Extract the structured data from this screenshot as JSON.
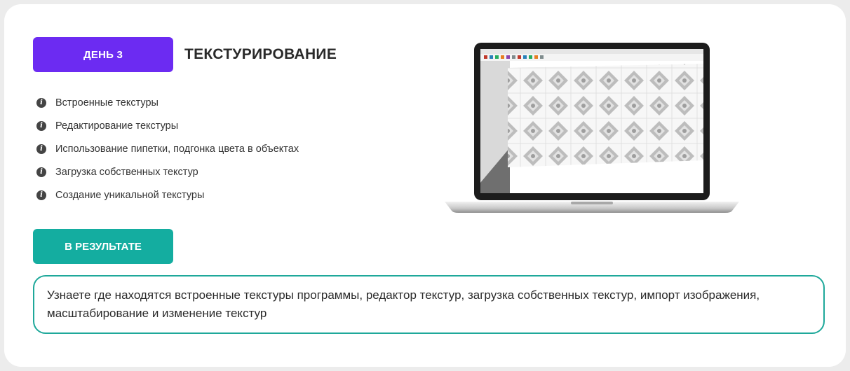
{
  "module": {
    "day_label": "ДЕНЬ 3",
    "title": "ТЕКСТУРИРОВАНИЕ",
    "accent_color": "#6c2bf2"
  },
  "topics": [
    {
      "icon": "info-icon",
      "label": "Встроенные текстуры"
    },
    {
      "icon": "info-icon",
      "label": "Редактирование текстуры"
    },
    {
      "icon": "info-icon",
      "label": "Использование пипетки, подгонка цвета в объектах"
    },
    {
      "icon": "info-icon",
      "label": "Загрузка собственных текстур"
    },
    {
      "icon": "info-icon",
      "label": "Создание уникальной текстуры"
    }
  ],
  "result": {
    "button_label": "В РЕЗУЛЬТАТЕ",
    "button_color": "#14ada0",
    "description": "Узнаете где находятся встроенные текстуры программы, редактор текстур, загрузка собственных текстур, импорт изображения, масштабирование и изменение текстур"
  },
  "illustration": {
    "subject": "laptop-icon",
    "screen_content": "texture-tile-grid"
  }
}
